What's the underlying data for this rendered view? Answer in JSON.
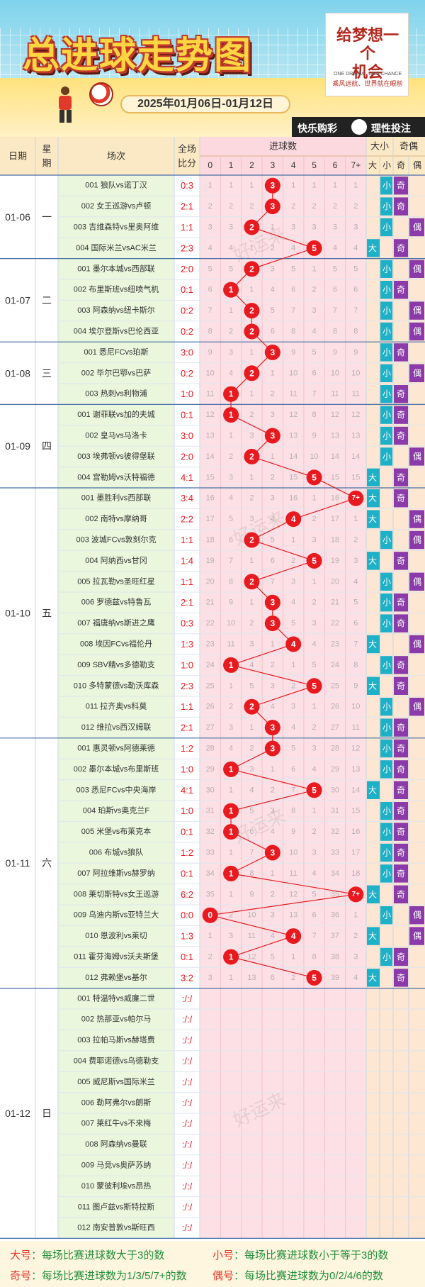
{
  "header": {
    "title": "总进球走势图",
    "date_range": "2025年01月06日-01月12日",
    "brand_card": {
      "line1": "给梦想一个",
      "line2": "机会",
      "english": "ONE DREAM、ONE CHANCE",
      "slogan": "乘风远航、世界就在眼前"
    },
    "brand_left": "快乐购彩",
    "brand_right": "理性投注"
  },
  "table": {
    "headers": {
      "date": "日期",
      "weekday": "星期",
      "match": "场次",
      "score": "全场比分",
      "goals": "进球数",
      "bigsmall": "大小",
      "oddeven": "奇偶",
      "big": "大",
      "small": "小",
      "odd": "奇",
      "even": "偶"
    },
    "goal_labels": [
      "0",
      "1",
      "2",
      "3",
      "4",
      "5",
      "6",
      "7+"
    ],
    "watermark": "好运来"
  },
  "chart_data": {
    "type": "table",
    "days": [
      {
        "date": "01-06",
        "weekday": "一",
        "matches": [
          {
            "match": "001 狼队vs诺丁汉",
            "score": "0:3",
            "total": 3
          },
          {
            "match": "002 女王巡游vs卢顿",
            "score": "2:1",
            "total": 3
          },
          {
            "match": "003 吉维森特vs里奥阿维",
            "score": "1:1",
            "total": 2
          },
          {
            "match": "004 国际米兰vsAC米兰",
            "score": "2:3",
            "total": 5
          }
        ]
      },
      {
        "date": "01-07",
        "weekday": "二",
        "matches": [
          {
            "match": "001 墨尔本城vs西部联",
            "score": "2:0",
            "total": 2
          },
          {
            "match": "002 布里斯班vs纽喷气机",
            "score": "0:1",
            "total": 1
          },
          {
            "match": "003 阿森纳vs纽卡斯尔",
            "score": "0:2",
            "total": 2
          },
          {
            "match": "004 埃尔登斯vs巴伦西亚",
            "score": "0:2",
            "total": 2
          }
        ]
      },
      {
        "date": "01-08",
        "weekday": "三",
        "matches": [
          {
            "match": "001 悉尼FCvs珀斯",
            "score": "3:0",
            "total": 3
          },
          {
            "match": "002 毕尔巴鄂vs巴萨",
            "score": "0:2",
            "total": 2
          },
          {
            "match": "003 热刺vs利物浦",
            "score": "1:0",
            "total": 1
          }
        ]
      },
      {
        "date": "01-09",
        "weekday": "四",
        "matches": [
          {
            "match": "001 谢菲联vs加的夫城",
            "score": "0:1",
            "total": 1
          },
          {
            "match": "002 皇马vs马洛卡",
            "score": "3:0",
            "total": 3
          },
          {
            "match": "003 埃弗顿vs彼得堡联",
            "score": "2:0",
            "total": 2
          },
          {
            "match": "004 宫勒姆vs沃特福德",
            "score": "4:1",
            "total": 5
          }
        ]
      },
      {
        "date": "01-10",
        "weekday": "五",
        "matches": [
          {
            "match": "001 墨胜利vs西部联",
            "score": "3:4",
            "total": 7
          },
          {
            "match": "002 南特vs摩纳哥",
            "score": "2:2",
            "total": 4
          },
          {
            "match": "003 波城FCvs敦刻尔克",
            "score": "1:1",
            "total": 2
          },
          {
            "match": "004 阿纳西vs甘冈",
            "score": "1:4",
            "total": 5
          },
          {
            "match": "005 拉瓦勒vs圣旺红星",
            "score": "1:1",
            "total": 2
          },
          {
            "match": "006 罗德兹vs特鲁瓦",
            "score": "2:1",
            "total": 3
          },
          {
            "match": "007 福唐纳vs斯进之鹰",
            "score": "0:3",
            "total": 3
          },
          {
            "match": "008 埃因FCvs福伦丹",
            "score": "1:3",
            "total": 4
          },
          {
            "match": "009 SBV精vs多德勒支",
            "score": "1:0",
            "total": 1
          },
          {
            "match": "010 多特蒙德vs勒沃库森",
            "score": "2:3",
            "total": 5
          },
          {
            "match": "011 拉齐奥vs科莫",
            "score": "1:1",
            "total": 2
          },
          {
            "match": "012 维拉vs西汉姆联",
            "score": "2:1",
            "total": 3
          }
        ]
      },
      {
        "date": "01-11",
        "weekday": "六",
        "matches": [
          {
            "match": "001 惠灵顿vs阿德莱德",
            "score": "1:2",
            "total": 3
          },
          {
            "match": "002 墨尔本城vs布里斯班",
            "score": "1:0",
            "total": 1
          },
          {
            "match": "003 悉尼FCvs中央海岸",
            "score": "4:1",
            "total": 5
          },
          {
            "match": "004 珀斯vs奥克兰F",
            "score": "1:0",
            "total": 1
          },
          {
            "match": "005 米堡vs布莱克本",
            "score": "0:1",
            "total": 1
          },
          {
            "match": "006 布城vs狼队",
            "score": "1:2",
            "total": 3
          },
          {
            "match": "007 阿拉维斯vs赫罗纳",
            "score": "0:1",
            "total": 1
          },
          {
            "match": "008 莱切斯特vs女王巡游",
            "score": "6:2",
            "total": 7
          },
          {
            "match": "009 乌迪内斯vs亚特兰大",
            "score": "0:0",
            "total": 0
          },
          {
            "match": "010 恩波利vs莱切",
            "score": "1:3",
            "total": 4
          },
          {
            "match": "011 霍芬海姆vs沃夫斯堡",
            "score": "0:1",
            "total": 1
          },
          {
            "match": "012 弗赖堡vs基尔",
            "score": "3:2",
            "total": 5
          }
        ]
      },
      {
        "date": "01-12",
        "weekday": "日",
        "matches": [
          {
            "match": "001 特温特vs威廉二世",
            "score": ":/:/"
          },
          {
            "match": "002 热那亚vs帕尔马",
            "score": ":/:/"
          },
          {
            "match": "003 拉帕马斯vs赫塔费",
            "score": ":/:/"
          },
          {
            "match": "004 费耶诺德vs乌德勒支",
            "score": ":/:/"
          },
          {
            "match": "005 威尼斯vs国际米兰",
            "score": ":/:/"
          },
          {
            "match": "006 勒阿弗尔vs朗斯",
            "score": ":/:/"
          },
          {
            "match": "007 莱红牛vs不来梅",
            "score": ":/:/"
          },
          {
            "match": "008 阿森纳vs曼联",
            "score": ":/:/"
          },
          {
            "match": "009 马竞vs奥萨苏纳",
            "score": ":/:/"
          },
          {
            "match": "010 蒙彼利埃vs昂热",
            "score": ":/:/"
          },
          {
            "match": "011 图卢兹vs斯特拉斯",
            "score": ":/:/"
          },
          {
            "match": "012 南安普敦vs斯旺西",
            "score": ":/:/"
          }
        ]
      }
    ]
  },
  "legend": {
    "big_key": "大号",
    "big_text": "：每场比赛进球数大于3的数",
    "small_key": "小号",
    "small_text": "：每场比赛进球数小于等于3的数",
    "odd_key": "奇号",
    "odd_text": "：每场比赛进球数为1/3/5/7+的数",
    "even_key": "偶号",
    "even_text": "：每场比赛进球数为0/2/4/6的数"
  },
  "colors": {
    "red": "#e8191f",
    "teal": "#1eb0c6",
    "purple": "#8a3aa9",
    "green": "#2e8b3e",
    "pink": "#fde0e5",
    "cream": "#fff6e0"
  }
}
